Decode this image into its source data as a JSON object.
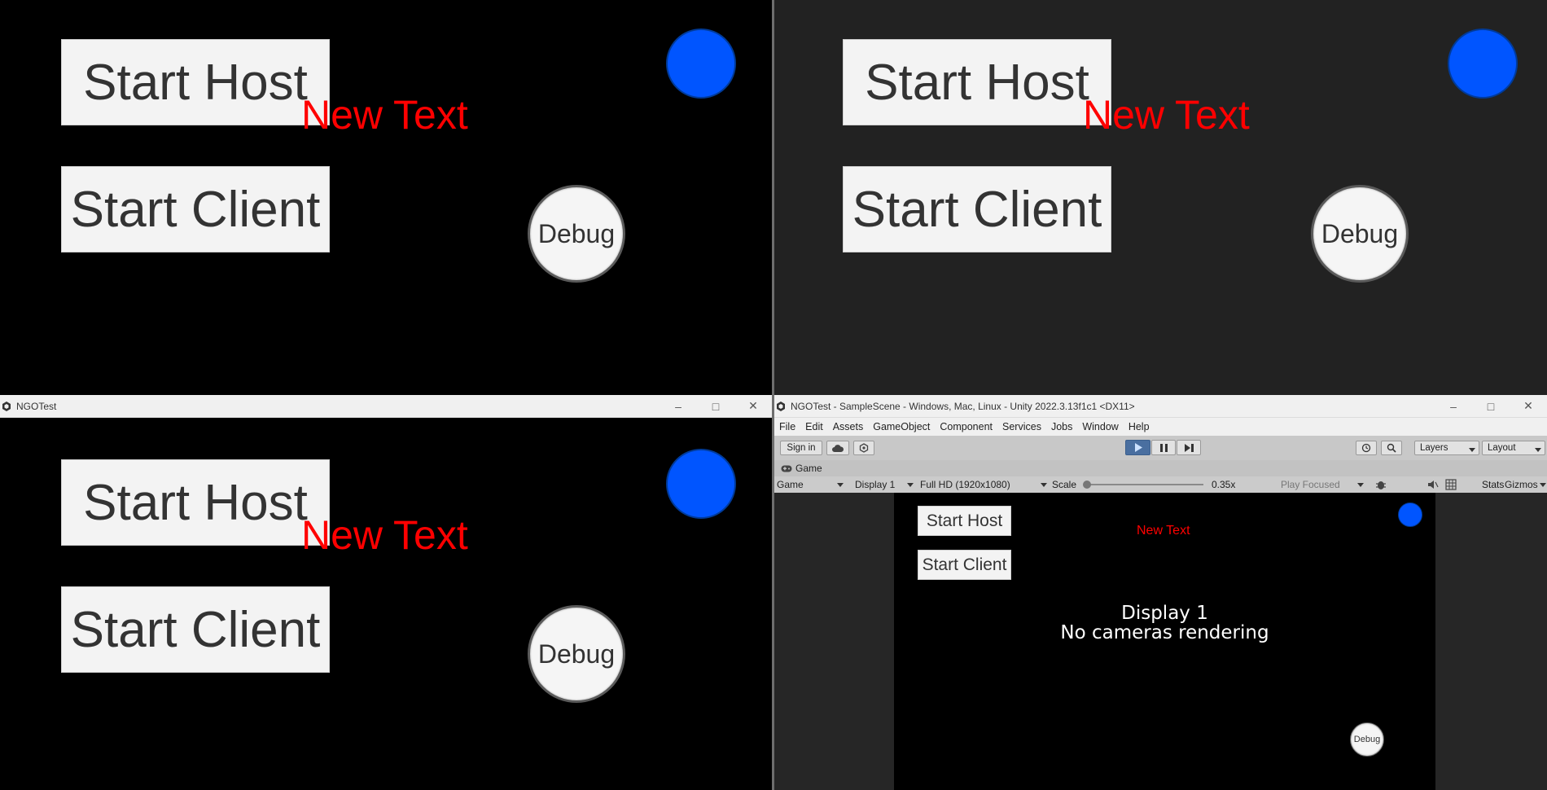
{
  "game_ui": {
    "start_host_label": "Start Host",
    "start_client_label": "Start Client",
    "new_text": "New Text",
    "debug_label": "Debug"
  },
  "player_window": {
    "title": "NGOTest"
  },
  "editor": {
    "title": "NGOTest - SampleScene - Windows, Mac, Linux - Unity 2022.3.13f1c1 <DX11>",
    "menu": [
      "File",
      "Edit",
      "Assets",
      "GameObject",
      "Component",
      "Services",
      "Jobs",
      "Window",
      "Help"
    ],
    "toolbar": {
      "sign_in": "Sign in",
      "layers": "Layers",
      "layout": "Layout"
    },
    "game_tab": {
      "label": "Game",
      "mode": "Game",
      "display": "Display 1",
      "resolution": "Full HD (1920x1080)",
      "scale_label": "Scale",
      "scale_value": "0.35x",
      "play_focused": "Play Focused",
      "stats": "Stats",
      "gizmos": "Gizmos"
    },
    "viewport": {
      "display_line": "Display 1",
      "no_cameras_line": "No cameras rendering"
    }
  },
  "colors": {
    "accent_blue": "#0055ff",
    "new_text_red": "#ff0000",
    "dark_bg": "#222222"
  },
  "icons": [
    "unity-logo-icon",
    "minimize-icon",
    "maximize-icon",
    "close-icon",
    "cloud-icon",
    "settings-icon",
    "play-icon",
    "pause-icon",
    "step-icon",
    "history-icon",
    "search-icon",
    "gamepad-icon",
    "bug-icon",
    "mute-icon",
    "grid-icon"
  ]
}
